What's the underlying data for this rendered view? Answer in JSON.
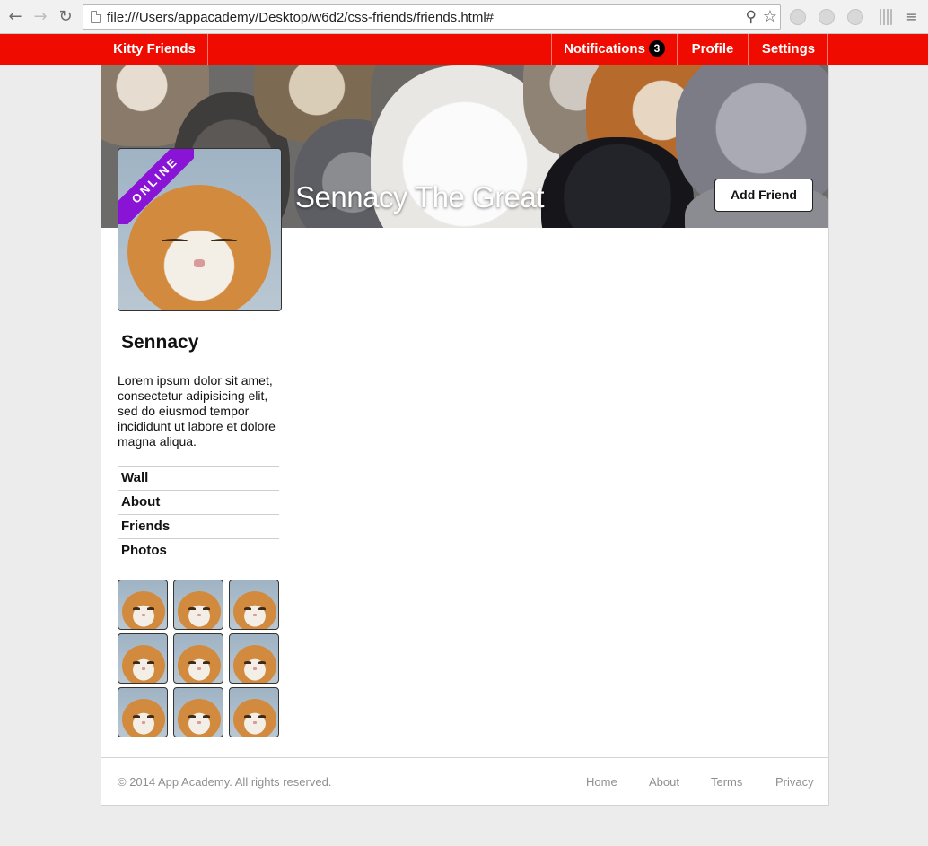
{
  "browser": {
    "url": "file:///Users/appacademy/Desktop/w6d2/css-friends/friends.html#",
    "back_icon": "back-arrow-icon",
    "forward_icon": "forward-arrow-icon",
    "reload_icon": "reload-icon"
  },
  "topbar": {
    "brand": "Kitty Friends",
    "notifications_label": "Notifications",
    "notifications_count": "3",
    "profile_label": "Profile",
    "settings_label": "Settings",
    "bar_color": "#ef0b00"
  },
  "cover": {
    "title": "Sennacy The Great",
    "add_friend_label": "Add Friend"
  },
  "profile": {
    "status_ribbon": "ONLINE",
    "ribbon_color": "#8a14d6",
    "name": "Sennacy",
    "bio": "Lorem ipsum dolor sit amet, consectetur adipisicing elit, sed do eiusmod tempor incididunt ut labore et dolore magna aliqua."
  },
  "sidebar": {
    "items": [
      {
        "label": "Wall"
      },
      {
        "label": "About"
      },
      {
        "label": "Friends"
      },
      {
        "label": "Photos"
      }
    ]
  },
  "photos": {
    "count": 9
  },
  "footer": {
    "copyright": "© 2014 App Academy. All rights reserved.",
    "links": [
      {
        "label": "Home"
      },
      {
        "label": "About"
      },
      {
        "label": "Terms"
      },
      {
        "label": "Privacy"
      }
    ]
  }
}
